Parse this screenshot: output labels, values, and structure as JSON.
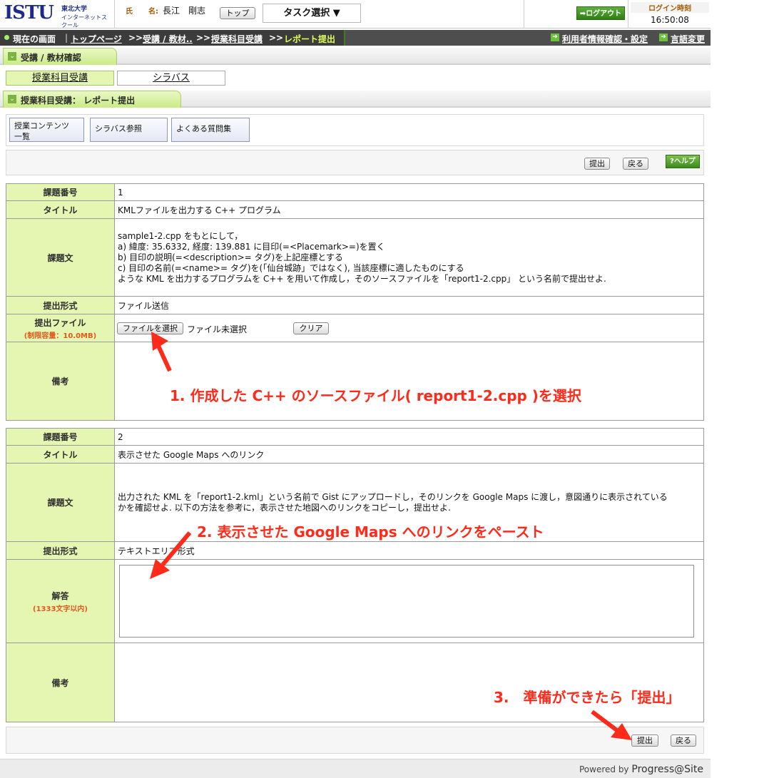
{
  "header": {
    "logo_mark": "ISTU",
    "logo_sub1": "東北大学",
    "logo_sub2": "インターネットスクール",
    "name_label_1": "氏",
    "name_label_2": "名:",
    "user_name": "長江　剛志",
    "top_button": "トップ",
    "task_select": "タスク選択 ▼",
    "logout_button": "ログアウト",
    "login_time_label": "ログイン時刻",
    "login_time": "16:50:08"
  },
  "breadcrumb": {
    "current_label": "現在の画面",
    "items": [
      "トップページ",
      "受講 / 教材..",
      "授業科目受講",
      "レポート提出"
    ],
    "separator": ">>",
    "right_links": [
      "利用者情報確認・設定",
      "言語変更"
    ]
  },
  "sections": {
    "attend": "受講 / 教材確認",
    "report": "授業科目受講： レポート提出"
  },
  "subtabs": [
    "授業科目受講",
    "シラバス"
  ],
  "function_buttons": [
    {
      "line1": "授業コンテンツ",
      "line2": "一覧"
    },
    {
      "line1": "シラバス参照",
      "line2": ""
    },
    {
      "line1": "よくある質問集",
      "line2": ""
    }
  ],
  "actions": {
    "submit": "提出",
    "back": "戻る",
    "help": "?ヘルプ"
  },
  "assignment1": {
    "labels": {
      "number": "課題番号",
      "title": "タイトル",
      "body": "課題文",
      "format": "提出形式",
      "file": "提出ファイル",
      "file_note": "(制限容量：10.0MB)",
      "remarks": "備考"
    },
    "number": "1",
    "title": "KMLファイルを出力する C++ プログラム",
    "body_lines": [
      "sample1-2.cpp をもとにして，",
      "a) 緯度: 35.6332, 経度: 139.881 に目印(=<Placemark>=)を置く",
      "b) 目印の説明(=<description>= タグ)を上記座標とする",
      "c) 目印の名前(=<name>= タグ)を(「仙台城跡」ではなく), 当該座標に適したものにする",
      "ような KML を出力するプログラムを C++ を用いて作成し，そのソースファイルを「report1-2.cpp」 という名前で提出せよ."
    ],
    "format": "ファイル送信",
    "file_button": "ファイルを選択",
    "file_status": "ファイル未選択",
    "clear_button": "クリア"
  },
  "assignment2": {
    "labels": {
      "number": "課題番号",
      "title": "タイトル",
      "body": "課題文",
      "format": "提出形式",
      "answer": "解答",
      "answer_note": "(1333文字以内)",
      "remarks": "備考"
    },
    "number": "2",
    "title": "表示させた Google Maps へのリンク",
    "body_lines": [
      "出力された KML を「report1-2.kml」という名前で Gist にアップロードし，そのリンクを Google Maps に渡し，意図通りに表示されている",
      "かを確認せよ.  以下の方法を参考に，表示させた地図へのリンクをコピーし，提出せよ."
    ],
    "format": "テキストエリア形式",
    "answer_value": ""
  },
  "annotations": {
    "step1": "1. 作成した C++ のソースファイル( report1-2.cpp )を選択",
    "step2": "2. 表示させた Google Maps へのリンクをペースト",
    "step3": "3.　準備ができたら「提出」"
  },
  "colors": {
    "label_bg": "#e5f5b2",
    "annotation_red": "#ff2a1a",
    "brand_navy": "#1d2b86",
    "green_button": "#3d8a1d"
  },
  "footer": {
    "powered_by": "Powered by",
    "brand": "Progress@Site"
  }
}
